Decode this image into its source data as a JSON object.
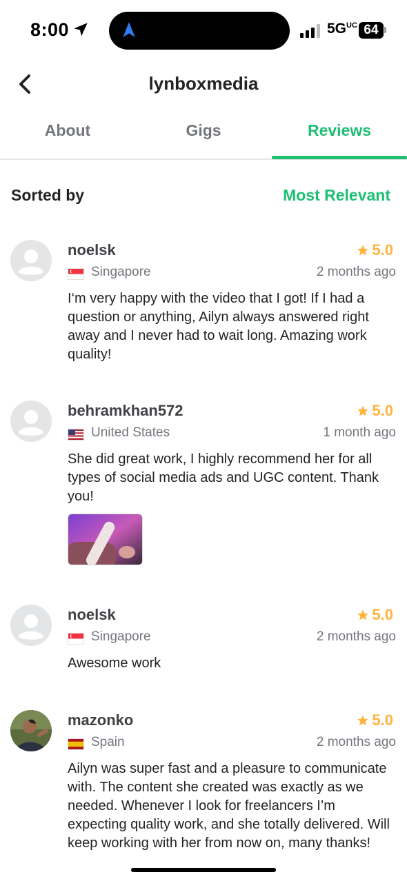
{
  "status_bar": {
    "time": "8:00",
    "network": "5G",
    "network_suffix": "UC",
    "battery": "64"
  },
  "header": {
    "title": "lynboxmedia",
    "back_icon": "chevron-left-icon"
  },
  "tabs": [
    {
      "label": "About",
      "active": false
    },
    {
      "label": "Gigs",
      "active": false
    },
    {
      "label": "Reviews",
      "active": true
    }
  ],
  "sort": {
    "label": "Sorted by",
    "value": "Most Relevant"
  },
  "colors": {
    "accent": "#1dbf73",
    "star": "#ffb33e",
    "muted": "#74767e"
  },
  "reviews": [
    {
      "name": "noelsk",
      "rating": "5.0",
      "country": "Singapore",
      "flag": "singapore-flag-icon",
      "time": "2 months ago",
      "text": "I‘m very happy with the video that I got! If I had a question or anything, Ailyn always answered right away and I never had to wait long. Amazing work quality!"
    },
    {
      "name": "behramkhan572",
      "rating": "5.0",
      "country": "United States",
      "flag": "us-flag-icon",
      "time": "1 month ago",
      "text": "She did great work, I highly recommend her for all types of social media ads and UGC content. Thank you!",
      "has_attachment": true
    },
    {
      "name": "noelsk",
      "rating": "5.0",
      "country": "Singapore",
      "flag": "singapore-flag-icon",
      "time": "2 months ago",
      "text": "Awesome work"
    },
    {
      "name": "mazonko",
      "rating": "5.0",
      "country": "Spain",
      "flag": "spain-flag-icon",
      "time": "2 months ago",
      "text": "Ailyn was super fast and a pleasure to communicate with. The content she created was exactly as we needed. Whenever I look for freelancers I’m expecting quality work, and she totally delivered. Will keep working with her from now on, many thanks!"
    }
  ]
}
